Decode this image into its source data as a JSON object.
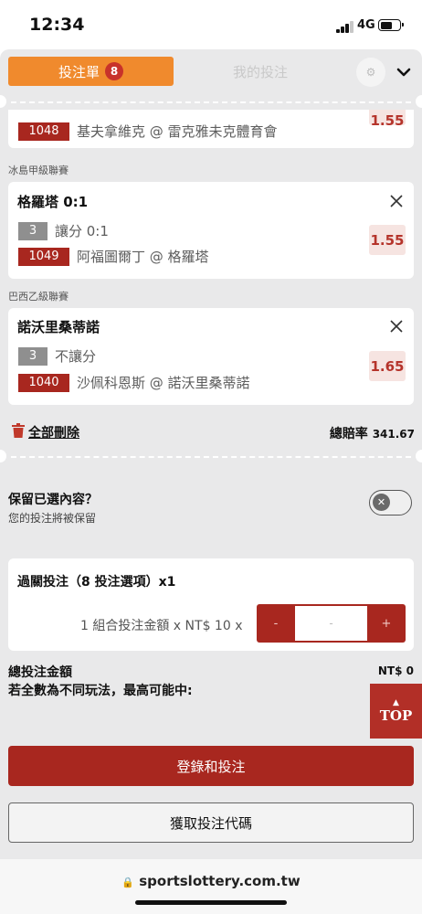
{
  "status_bar": {
    "time": "12:34",
    "network": "4G"
  },
  "tabs": {
    "active_label": "投注單",
    "badge_count": "8",
    "other_label": "我的投注"
  },
  "partial_card": {
    "code": "1048",
    "match": "基夫拿維克 @ 雷克雅未克體育會",
    "odds": "1.55"
  },
  "bets": [
    {
      "league": "冰島甲級聯賽",
      "title": "格羅塔 0:1",
      "num": "3",
      "market": "讓分 0:1",
      "code": "1049",
      "match": "阿福圖爾丁 @ 格羅塔",
      "odds": "1.55"
    },
    {
      "league": "巴西乙級聯賽",
      "title": "諾沃里桑蒂諾",
      "num": "3",
      "market": "不讓分",
      "code": "1040",
      "match": "沙佩科恩斯 @ 諾沃里桑蒂諾",
      "odds": "1.65"
    }
  ],
  "actions": {
    "delete_all": "全部刪除",
    "total_odds_label": "總賠率",
    "total_odds_value": "341.67"
  },
  "retain": {
    "title": "保留已選內容？",
    "subtitle": "您的投注將被保留"
  },
  "parlay": {
    "title": "過關投注（8 投注選項）x1",
    "unit_label": "1 組合投注金額 x NT$ 10 x",
    "minus": "-",
    "value": "-",
    "plus": "+"
  },
  "summary": {
    "total_label": "總投注金額",
    "total_value": "NT$ 0",
    "max_win_label": "若全數為不同玩法，最高可能中:"
  },
  "top_button": {
    "arrow": "▲",
    "label": "TOP"
  },
  "buttons": {
    "login_bet": "登錄和投注",
    "get_code": "獲取投注代碼"
  },
  "browser": {
    "url": "sportslottery.com.tw",
    "lock": "🔒"
  },
  "colors": {
    "accent_orange": "#f08a2d",
    "brand_red": "#a8271f",
    "panel_bg": "#e9e9ea"
  }
}
